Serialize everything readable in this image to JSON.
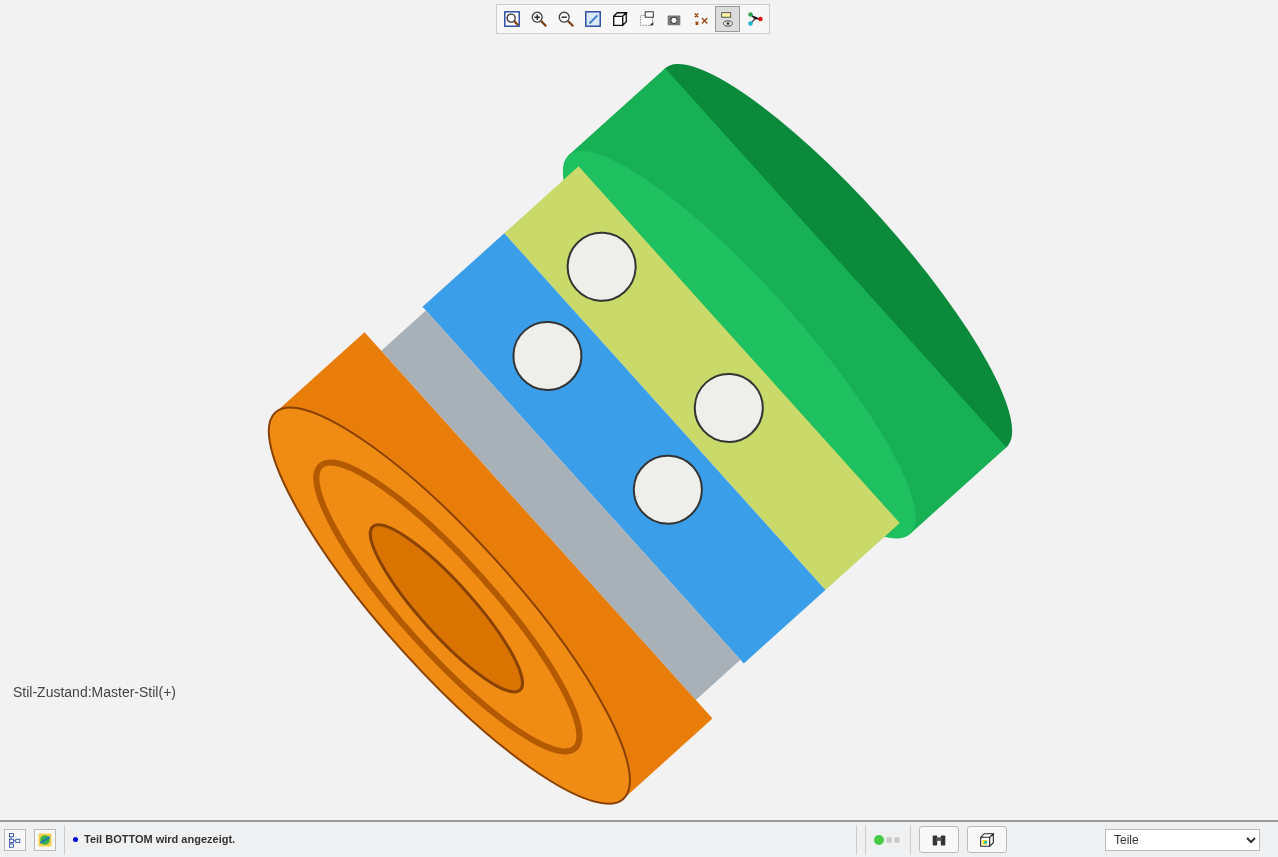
{
  "toolbar": [
    {
      "kind": "refit",
      "selected": false
    },
    {
      "kind": "zoom_in",
      "selected": false
    },
    {
      "kind": "zoom_out",
      "selected": false
    },
    {
      "kind": "repaint",
      "selected": false
    },
    {
      "kind": "cube",
      "selected": false
    },
    {
      "kind": "annotation",
      "selected": false
    },
    {
      "kind": "camera",
      "selected": false
    },
    {
      "kind": "points",
      "selected": false
    },
    {
      "kind": "filter",
      "selected": true
    },
    {
      "kind": "nodes",
      "selected": false
    }
  ],
  "viewport": {
    "style_state": "Stil-Zustand:Master-Stil(+)"
  },
  "status_bar": {
    "left_buttons": [
      {
        "kind": "tree"
      },
      {
        "kind": "globe"
      }
    ],
    "message": "Teil BOTTOM wird angezeigt.",
    "right_buttons": [
      {
        "kind": "find"
      },
      {
        "kind": "box"
      }
    ],
    "filter": {
      "value": "Teile"
    }
  }
}
